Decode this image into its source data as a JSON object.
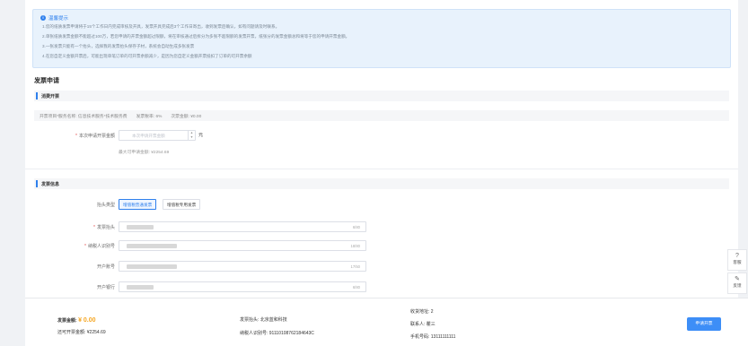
{
  "notice": {
    "title": "温馨提示",
    "lines": [
      "1.您的纸质发票申请将于15个工作日内完成审核及开具，发票开具完成后3个工作日寄出，收到发票后确认，如有问题请及时联系。",
      "2.单张纸质发票金额不能超过100万，若您申请的开票金额超过限额，将在审核通过后拆分为多张不超限额的发票开票，纸张分的发票金额总和将等于您的申请开票金额。",
      "3.一张发票只能有一个抬头，选择我的发票抬头保存子材，系统会自动生成多张发票",
      "4.在您自定义金额开票后，可能出现单笔订单的可开票余额减少，是因为您自定义金额开票抵扣了订单的可开票余额"
    ]
  },
  "apply": {
    "section_title": "发票申请",
    "sub_title": "消费开票",
    "service_name_label": "开票项目*服务名称:",
    "service_name": "信息技术服务*技术服务费",
    "tax_rate_label": "发票税率:",
    "tax_rate": "6%",
    "issued_amount_label": "次票金额:",
    "issued_amount": "¥0.00",
    "amount_label": "本次申请开票金额",
    "amount_placeholder": "本次申请开票金额",
    "amount_unit": "元",
    "max_hint": "最大可申请金额: ¥2254.69"
  },
  "invoice_info": {
    "sub_title": "发票信息",
    "header_type_label": "抬头类型",
    "type_options": [
      "增值税普通发票",
      "增值税专用发票"
    ],
    "fields": [
      {
        "label": "发票抬头",
        "required": true,
        "counter": "6/80"
      },
      {
        "label": "纳税人识别号",
        "required": true,
        "counter": "18/80"
      },
      {
        "label": "开户账号",
        "required": false,
        "counter": "17/50"
      },
      {
        "label": "开户银行",
        "required": false,
        "counter": "6/80"
      }
    ]
  },
  "side_tools": [
    {
      "icon": "help-icon",
      "glyph": "?",
      "label": "客服"
    },
    {
      "icon": "edit-icon",
      "glyph": "✎",
      "label": "反馈"
    }
  ],
  "footer": {
    "amount_label": "发票金额:",
    "amount": "¥ 0.00",
    "remaining_label": "还可开票金额:",
    "remaining": "¥2254.69",
    "title_label": "发票抬头:",
    "title_value": "北京蓝和科技",
    "tax_label": "纳税人识别号:",
    "tax_value": "91110108762184643C",
    "address_label": "收货地址:",
    "address_value": "2",
    "contact_label": "联系人:",
    "contact_value": "瞿三",
    "phone_label": "手机号码:",
    "phone_value": "13111111111",
    "apply_button": "申请开票"
  },
  "colors": {
    "accent": "#2f80ed",
    "amount": "#f5a623",
    "required": "#e34d4d"
  }
}
